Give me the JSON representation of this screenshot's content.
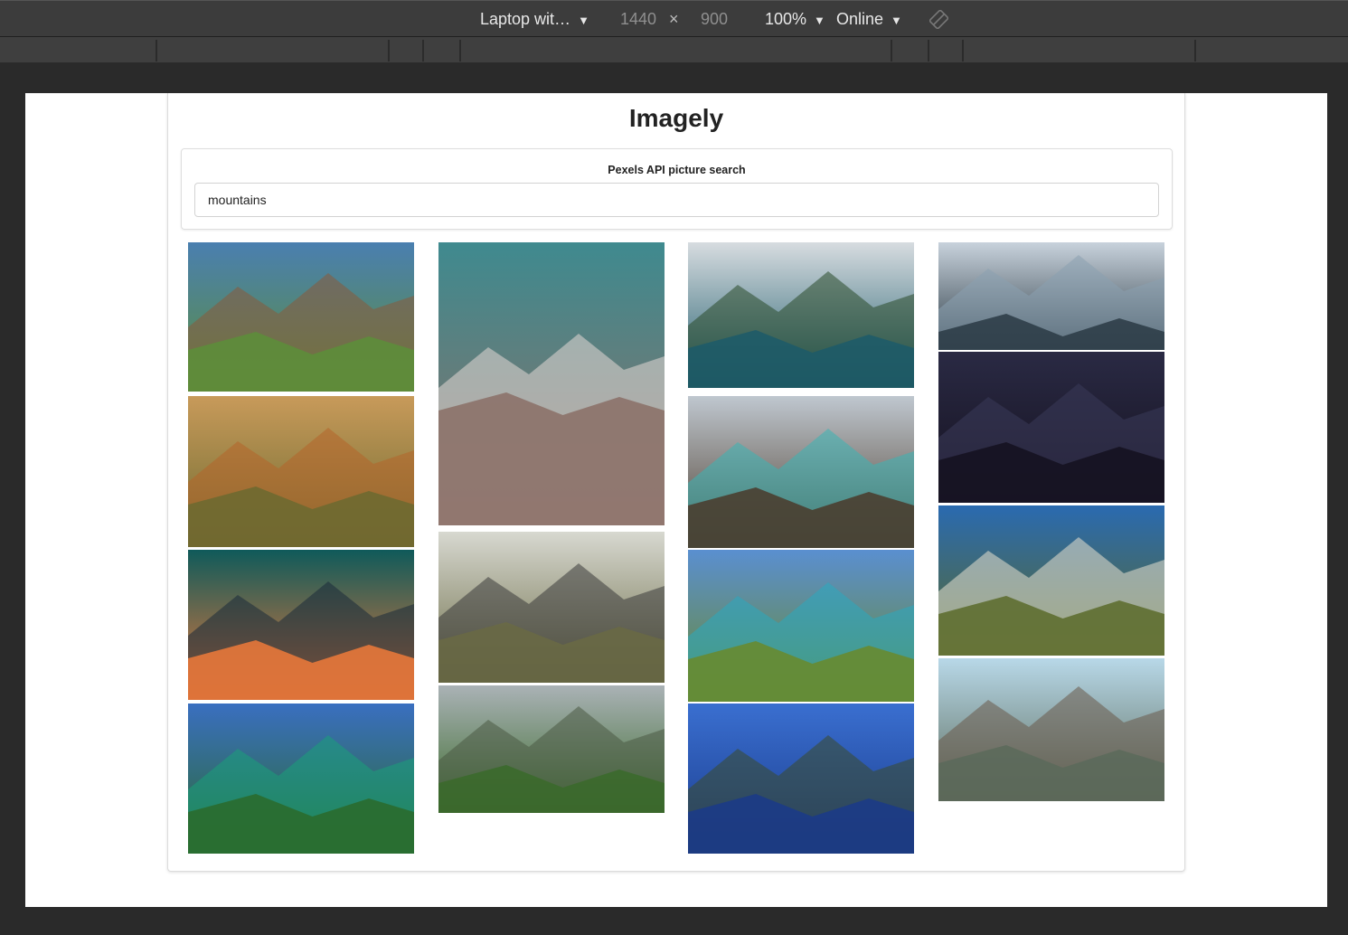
{
  "devtools": {
    "device": "Laptop wit…",
    "width": "1440",
    "times": "×",
    "height": "900",
    "zoom": "100%",
    "network": "Online"
  },
  "app": {
    "title": "Imagely",
    "search": {
      "label": "Pexels API picture search",
      "value": "mountains",
      "placeholder": ""
    },
    "photos": [
      {
        "scene": "railway-bridge",
        "sky": "#4a7fb0",
        "land": "#5c8f3a",
        "accent": "#8a5a3a"
      },
      {
        "scene": "sunset-hills",
        "sky": "#c89a5a",
        "land": "#6b6a30",
        "accent": "#b5652a"
      },
      {
        "scene": "teal-sunset-sky",
        "sky": "#0f5a5a",
        "land": "#f07a3a",
        "accent": "#1a2a3a"
      },
      {
        "scene": "alpine-green-lake",
        "sky": "#3a6fc0",
        "land": "#2a6a2a",
        "accent": "#1aa07a"
      },
      {
        "scene": "birds-over-rocks",
        "sky": "#3f8a8f",
        "land": "#8a6f66",
        "accent": "#e4d9d6"
      },
      {
        "scene": "road-to-mountains",
        "sky": "#d7d8d0",
        "land": "#6a6a44",
        "accent": "#3a3a3a"
      },
      {
        "scene": "valley-village",
        "sky": "#aab2b6",
        "land": "#3a6a2a",
        "accent": "#4a5a44"
      },
      {
        "scene": "lake-reflection-pines",
        "sky": "#d7dce0",
        "land": "#1c5a6a",
        "accent": "#2a4a2a"
      },
      {
        "scene": "turquoise-lake-forest",
        "sky": "#bfc7cf",
        "land": "#4a3a2a",
        "accent": "#3ab5b5"
      },
      {
        "scene": "green-alpine-lakes",
        "sky": "#5a8fd0",
        "land": "#6a8a2a",
        "accent": "#2aaac0"
      },
      {
        "scene": "crater-lake",
        "sky": "#3a6fd0",
        "land": "#1a3a8a",
        "accent": "#3a4a2a"
      },
      {
        "scene": "mirror-mountains",
        "sky": "#c8d2dc",
        "land": "#2a3a44",
        "accent": "#8aa0b0"
      },
      {
        "scene": "milky-way-lake",
        "sky": "#2a2a44",
        "land": "#14101e",
        "accent": "#3a3a5a"
      },
      {
        "scene": "blue-sky-plains",
        "sky": "#2a6ab0",
        "land": "#5a6a2a",
        "accent": "#e8e0d0"
      },
      {
        "scene": "dock-fjord",
        "sky": "#b8d8e8",
        "land": "#5a6a5a",
        "accent": "#6a5a4a"
      }
    ]
  }
}
